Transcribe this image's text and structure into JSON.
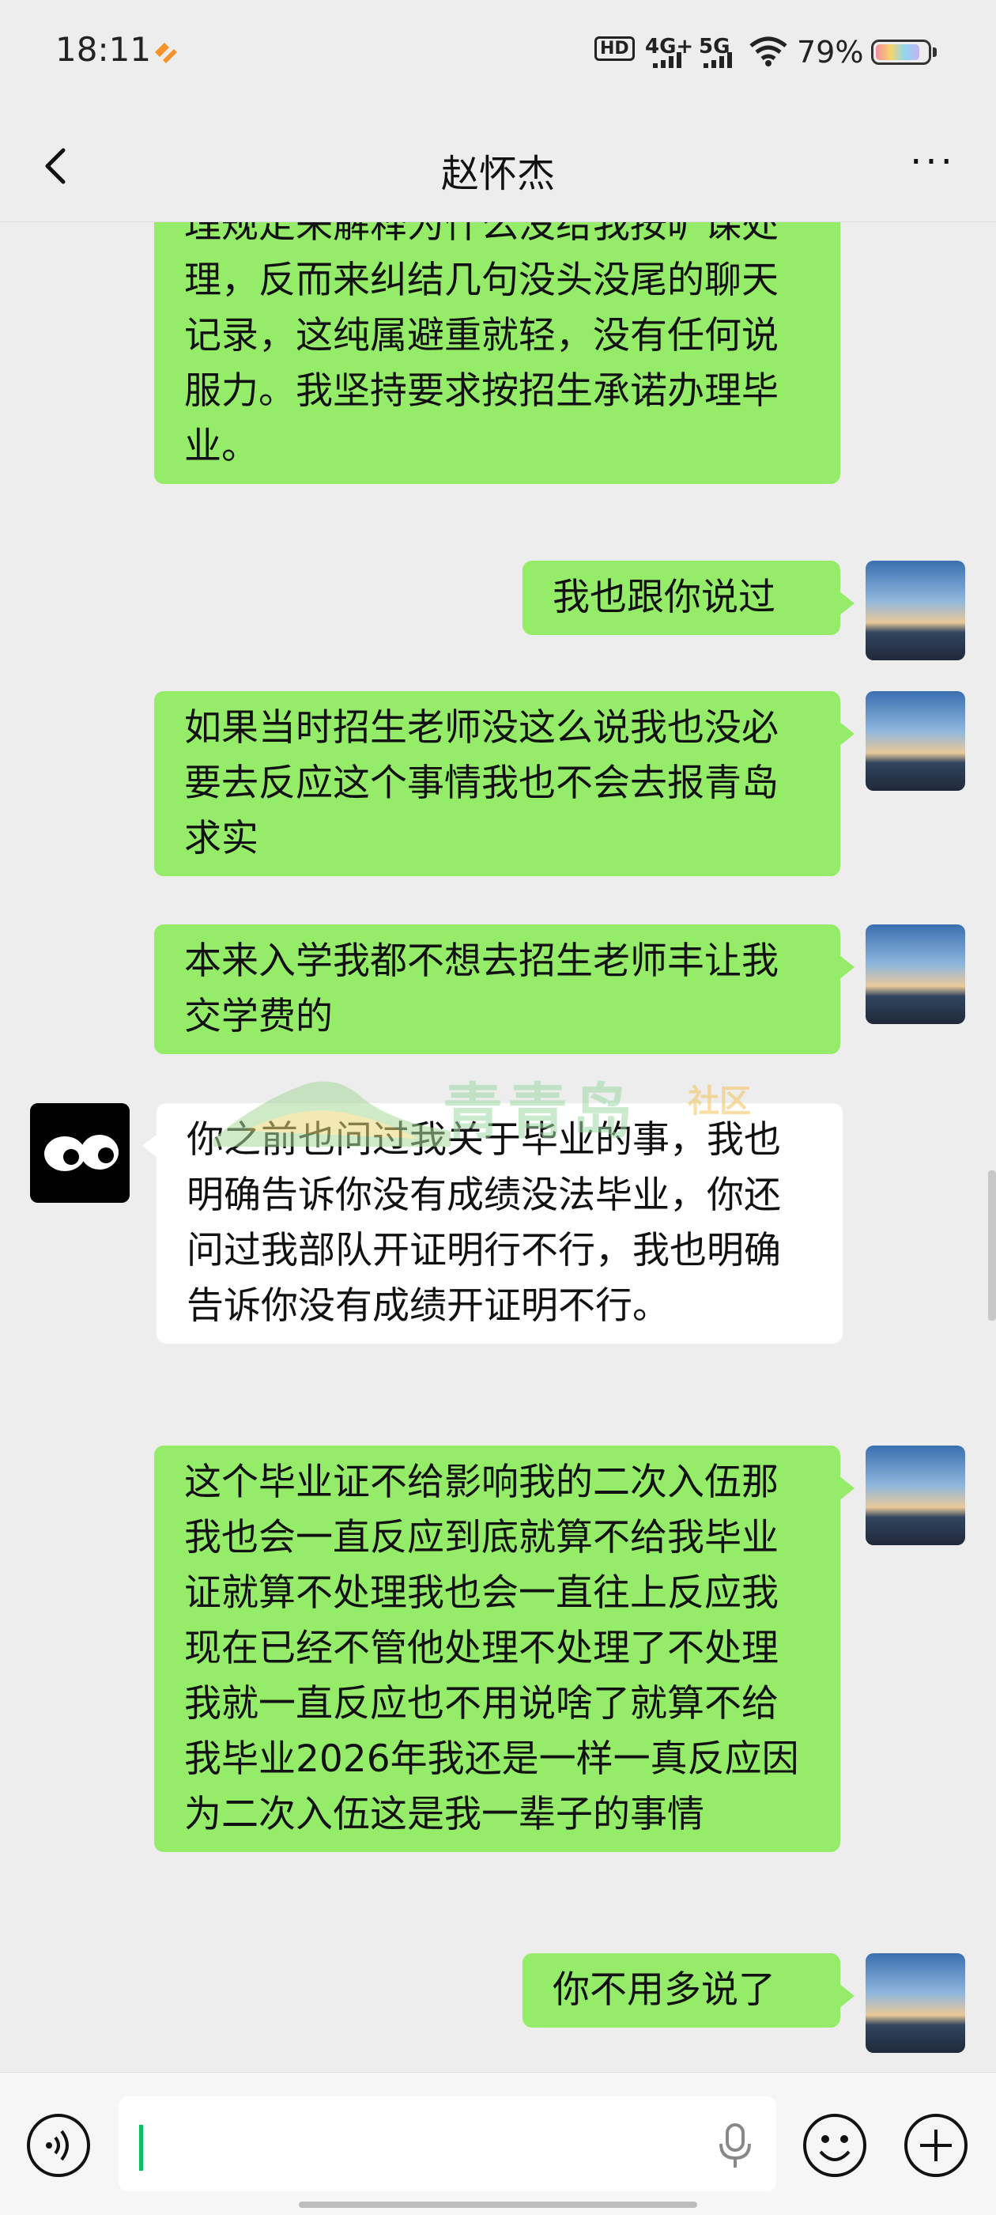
{
  "status_bar": {
    "time": "18:11",
    "hd_label": "HD",
    "net1": "4G+",
    "net2": "5G",
    "battery": "79%",
    "battery_level": 0.79
  },
  "header": {
    "title": "赵怀杰",
    "more_label": "···"
  },
  "messages": [
    {
      "side": "right",
      "text": "辛大工涯。现在拿个出当年的学籍管理规定来解释为什么没给我按旷课处理，反而来纠结几句没头没尾的聊天记录，这纯属避重就轻，没有任何说服力。我坚持要求按招生承诺办理毕业。"
    },
    {
      "side": "right",
      "text": "我也跟你说过"
    },
    {
      "side": "right",
      "text": "如果当时招生老师没这么说我也没必要去反应这个事情我也不会去报青岛求实"
    },
    {
      "side": "right",
      "text": "本来入学我都不想去招生老师丰让我交学费的"
    },
    {
      "side": "left",
      "text": "你之前也问过我关于毕业的事，我也明确告诉你没有成绩没法毕业，你还问过我部队开证明行不行，我也明确告诉你没有成绩开证明不行。"
    },
    {
      "side": "right",
      "text": "这个毕业证不给影响我的二次入伍那我也会一直反应到底就算不给我毕业证就算不处理我也会一直往上反应我现在已经不管他处理不处理了不处理我就一直反应也不用说啥了就算不给我毕业2026年我还是一样一真反应因为二次入伍这是我一辈子的事情"
    },
    {
      "side": "right",
      "text": "你不用多说了"
    }
  ],
  "watermark": {
    "text": "青青岛",
    "sub": "社区"
  },
  "colors": {
    "self_bubble": "#95ec69",
    "other_bubble": "#ffffff",
    "background": "#ededed",
    "caret": "#07c160"
  }
}
